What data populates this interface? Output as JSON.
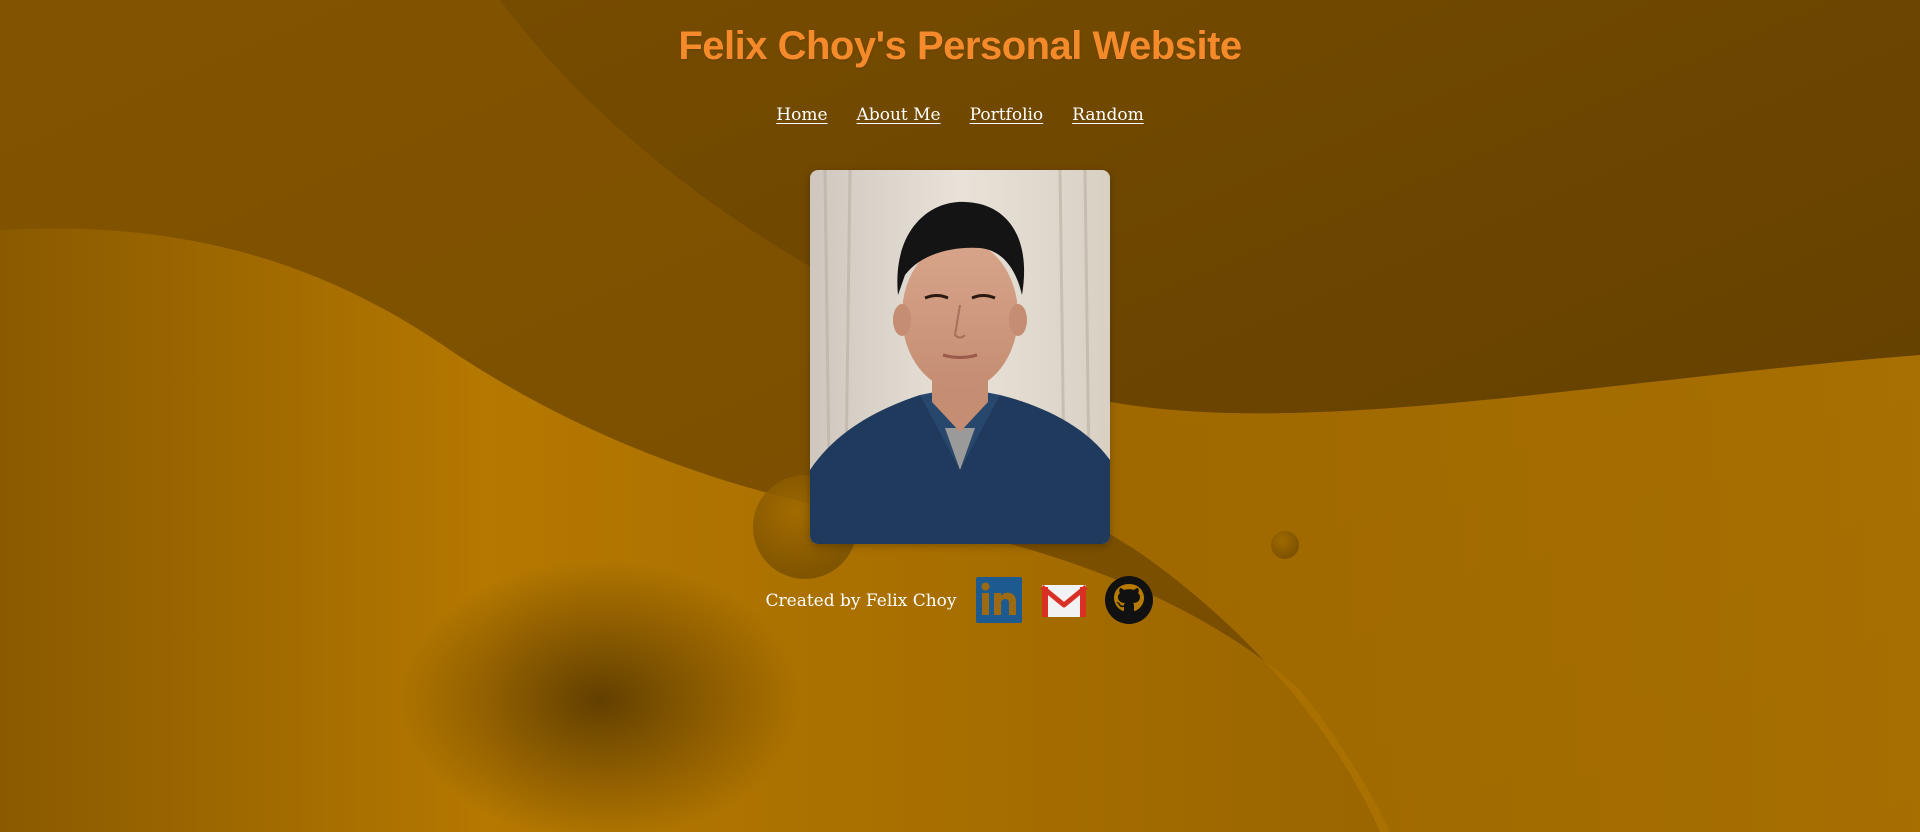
{
  "header": {
    "title": "Felix Choy's Personal Website"
  },
  "nav": {
    "items": [
      {
        "label": "Home"
      },
      {
        "label": "About Me"
      },
      {
        "label": "Portfolio"
      },
      {
        "label": "Random"
      }
    ]
  },
  "profile": {
    "photo_icon": "portrait-photo"
  },
  "footer": {
    "credit": "Created by Felix Choy",
    "social_links": [
      {
        "icon": "linkedin-icon"
      },
      {
        "icon": "gmail-icon"
      },
      {
        "icon": "github-icon"
      }
    ]
  },
  "colors": {
    "title": "#f58a2a",
    "background_dark": "#6b4500",
    "background_light": "#b87a00",
    "link": "#ffffff",
    "linkedin": "#0a66c2"
  }
}
